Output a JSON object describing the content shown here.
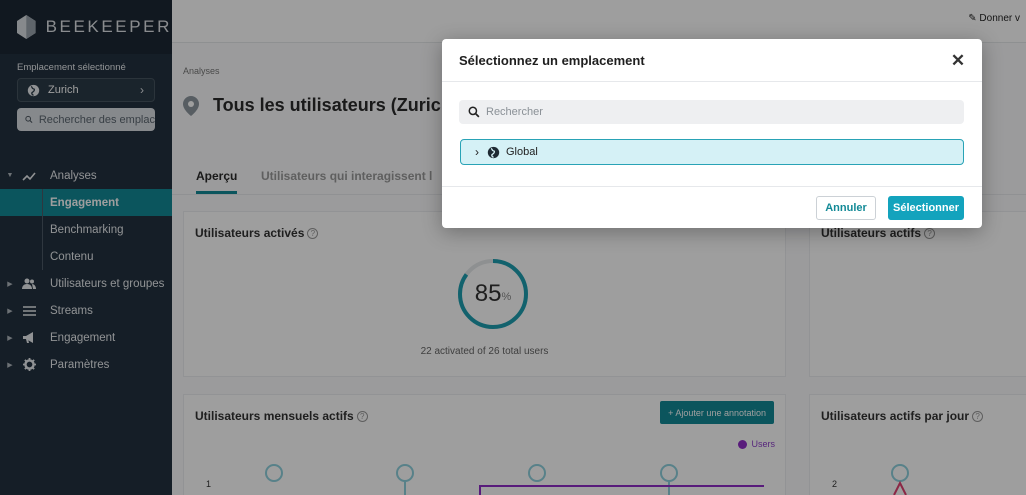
{
  "app": {
    "brand": "BEEKEEPER"
  },
  "sidebar": {
    "location_label": "Emplacement sélectionné",
    "location_value": "Zurich",
    "search_placeholder": "Rechercher des emplac",
    "nav": [
      {
        "label": "Analyses",
        "icon": "trending-up-icon",
        "expanded": true
      },
      {
        "label": "Utilisateurs et groupes",
        "icon": "users-icon"
      },
      {
        "label": "Streams",
        "icon": "list-icon"
      },
      {
        "label": "Engagement",
        "icon": "megaphone-icon"
      },
      {
        "label": "Paramètres",
        "icon": "gear-icon"
      }
    ],
    "analyses_sub": [
      {
        "label": "Engagement",
        "active": true
      },
      {
        "label": "Benchmarking"
      },
      {
        "label": "Contenu"
      }
    ]
  },
  "topbar": {
    "feedback": "Donner v"
  },
  "page": {
    "breadcrumb": "Analyses",
    "title": "Tous les utilisateurs (Zurich",
    "tabs": [
      "Aperçu",
      "Utilisateurs qui interagissent l"
    ]
  },
  "cards": {
    "activated": {
      "title": "Utilisateurs activés",
      "percent": "85",
      "percent_sign": "%",
      "percent_value": 85,
      "subtitle": "22 activated of 26 total users"
    },
    "active": {
      "title": "Utilisateurs actifs"
    },
    "monthly": {
      "title": "Utilisateurs mensuels actifs",
      "annotation_button": "+ Ajouter une annotation",
      "legend": "Users",
      "axis_tick": "1"
    },
    "daily": {
      "title": "Utilisateurs actifs par jour",
      "axis_tick": "2"
    }
  },
  "modal": {
    "title": "Sélectionnez un emplacement",
    "search_placeholder": "Rechercher",
    "node_label": "Global",
    "cancel": "Annuler",
    "select": "Sélectionner"
  },
  "colors": {
    "accent": "#138a97",
    "select_button": "#13a3bd",
    "sidebar": "#23313f",
    "series": "#8e2cc7"
  }
}
